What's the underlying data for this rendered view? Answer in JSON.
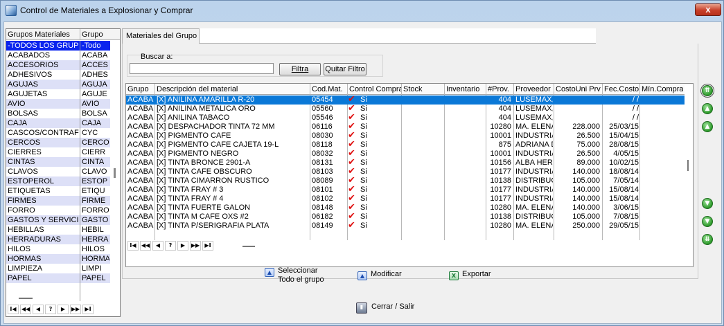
{
  "window": {
    "title": "Control de Materiales a Explosionar y Comprar",
    "close_label": "x"
  },
  "groups_panel": {
    "col_group_materials": "Grupos Materiales",
    "col_group": "Grupo",
    "rows": [
      {
        "name": "-TODOS LOS GRUPO",
        "code": "-Todo"
      },
      {
        "name": "ACABADOS",
        "code": "ACABA"
      },
      {
        "name": "ACCESORIOS",
        "code": "ACCES"
      },
      {
        "name": "ADHESIVOS",
        "code": "ADHES"
      },
      {
        "name": "AGUJAS",
        "code": "AGUJA"
      },
      {
        "name": "AGUJETAS",
        "code": "AGUJE"
      },
      {
        "name": "AVIO",
        "code": "AVIO"
      },
      {
        "name": "BOLSAS",
        "code": "BOLSA"
      },
      {
        "name": "CAJA",
        "code": "CAJA"
      },
      {
        "name": "CASCOS/CONTRAFU",
        "code": "CYC"
      },
      {
        "name": "CERCOS",
        "code": "CERCO"
      },
      {
        "name": "CIERRES",
        "code": "CIERR"
      },
      {
        "name": "CINTAS",
        "code": "CINTA"
      },
      {
        "name": "CLAVOS",
        "code": "CLAVO"
      },
      {
        "name": "ESTOPEROL",
        "code": "ESTOP"
      },
      {
        "name": "ETIQUETAS",
        "code": "ETIQU"
      },
      {
        "name": "FIRMES",
        "code": "FIRME"
      },
      {
        "name": "FORRO",
        "code": "FORRO"
      },
      {
        "name": "GASTOS Y SERVICIO",
        "code": "GASTO"
      },
      {
        "name": "HEBILLAS",
        "code": "HEBIL"
      },
      {
        "name": "HERRADURAS",
        "code": "HERRA"
      },
      {
        "name": "HILOS",
        "code": "HILOS"
      },
      {
        "name": "HORMAS",
        "code": "HORMA"
      },
      {
        "name": "LIMPIEZA",
        "code": "LIMPI"
      },
      {
        "name": "PAPEL",
        "code": "PAPEL"
      }
    ],
    "nav": [
      "I◀",
      "◀◀",
      "◀",
      "?",
      "▶",
      "▶▶",
      "▶I"
    ]
  },
  "tab": {
    "label": "Materiales del Grupo"
  },
  "search": {
    "label": "Buscar a:",
    "value": "",
    "filter_button": "Filtra",
    "clear_button": "Quitar Filtro"
  },
  "grid": {
    "headers": {
      "grupo": "Grupo",
      "descripcion": "Descripción del material",
      "codmat": "Cod.Mat.",
      "control": "Control Compra",
      "stock": "Stock",
      "inventario": "Inventario",
      "prov": "#Prov.",
      "proveedor": "Proveedor",
      "costo": "CostoUni Prv",
      "fecha": "Fec.Costo",
      "minimo": "Mín.Compra"
    },
    "rows": [
      {
        "grupo": "ACABA",
        "desc": "[X] ANILINA AMARILLA R-20",
        "cod": "05454",
        "control": "Si",
        "prov": "404",
        "proveedor": "LUSEMAX,",
        "costo": "",
        "fecha": "/ /"
      },
      {
        "grupo": "ACABA",
        "desc": "[X] ANILINA METALICA ORO",
        "cod": "05560",
        "control": "Si",
        "prov": "404",
        "proveedor": "LUSEMAX,",
        "costo": "",
        "fecha": "/ /"
      },
      {
        "grupo": "ACABA",
        "desc": "[X] ANILINA TABACO",
        "cod": "05546",
        "control": "Si",
        "prov": "404",
        "proveedor": "LUSEMAX,",
        "costo": "",
        "fecha": "/ /"
      },
      {
        "grupo": "ACABA",
        "desc": "[X] DESPACHADOR TINTA 72 MM",
        "cod": "06116",
        "control": "Si",
        "prov": "10280",
        "proveedor": "MA. ELENA",
        "costo": "228.000",
        "fecha": "25/03/15"
      },
      {
        "grupo": "ACABA",
        "desc": "[X] PIGMENTO CAFE",
        "cod": "08030",
        "control": "Si",
        "prov": "10001",
        "proveedor": "INDUSTRIA",
        "costo": "26.500",
        "fecha": "15/04/15"
      },
      {
        "grupo": "ACABA",
        "desc": "[X] PIGMENTO CAFE CAJETA 19-L",
        "cod": "08118",
        "control": "Si",
        "prov": "875",
        "proveedor": "ADRIANA D",
        "costo": "75.000",
        "fecha": "28/08/15"
      },
      {
        "grupo": "ACABA",
        "desc": "[X] PIGMENTO NEGRO",
        "cod": "08032",
        "control": "Si",
        "prov": "10001",
        "proveedor": "INDUSTRIA",
        "costo": "26.500",
        "fecha": "4/05/15"
      },
      {
        "grupo": "ACABA",
        "desc": "[X] TINTA BRONCE 2901-A",
        "cod": "08131",
        "control": "Si",
        "prov": "10156",
        "proveedor": "ALBA HER",
        "costo": "89.000",
        "fecha": "10/02/15"
      },
      {
        "grupo": "ACABA",
        "desc": "[X] TINTA CAFE OBSCURO",
        "cod": "08103",
        "control": "Si",
        "prov": "10177",
        "proveedor": "INDUSTRIA",
        "costo": "140.000",
        "fecha": "18/08/14"
      },
      {
        "grupo": "ACABA",
        "desc": "[X] TINTA CIMARRON RUSTICO",
        "cod": "08089",
        "control": "Si",
        "prov": "10138",
        "proveedor": "DISTRIBUC",
        "costo": "105.000",
        "fecha": "7/05/14"
      },
      {
        "grupo": "ACABA",
        "desc": "[X] TINTA FRAY # 3",
        "cod": "08101",
        "control": "Si",
        "prov": "10177",
        "proveedor": "INDUSTRIA",
        "costo": "140.000",
        "fecha": "15/08/14"
      },
      {
        "grupo": "ACABA",
        "desc": "[X] TINTA FRAY # 4",
        "cod": "08102",
        "control": "Si",
        "prov": "10177",
        "proveedor": "INDUSTRIA",
        "costo": "140.000",
        "fecha": "15/08/14"
      },
      {
        "grupo": "ACABA",
        "desc": "[X] TINTA FUERTE GALON",
        "cod": "08148",
        "control": "Si",
        "prov": "10280",
        "proveedor": "MA. ELENA",
        "costo": "140.000",
        "fecha": "3/06/15"
      },
      {
        "grupo": "ACABA",
        "desc": "[X] TINTA M CAFE OXS #2",
        "cod": "06182",
        "control": "Si",
        "prov": "10138",
        "proveedor": "DISTRIBUC",
        "costo": "105.000",
        "fecha": "7/08/15"
      },
      {
        "grupo": "ACABA",
        "desc": "[X] TINTA P/SERIGRAFIA PLATA",
        "cod": "08149",
        "control": "Si",
        "prov": "10280",
        "proveedor": "MA. ELENA",
        "costo": "250.000",
        "fecha": "29/05/15"
      }
    ],
    "check_glyph": "✔",
    "nav": [
      "I◀",
      "◀◀",
      "◀",
      "?",
      "▶",
      "▶▶",
      "▶I"
    ]
  },
  "side_arrows": [
    "⇈",
    "▲",
    "▲",
    "▼",
    "▼",
    "⇊"
  ],
  "actions": {
    "select_all_line1": "Seleccionar",
    "select_all_line2": "Todo el grupo",
    "select_icon": "▲",
    "modify": "Modificar",
    "modify_icon": "▲",
    "export": "Exportar",
    "export_icon": "X",
    "exit": "Cerrar / Salir",
    "exit_icon": "▮"
  }
}
